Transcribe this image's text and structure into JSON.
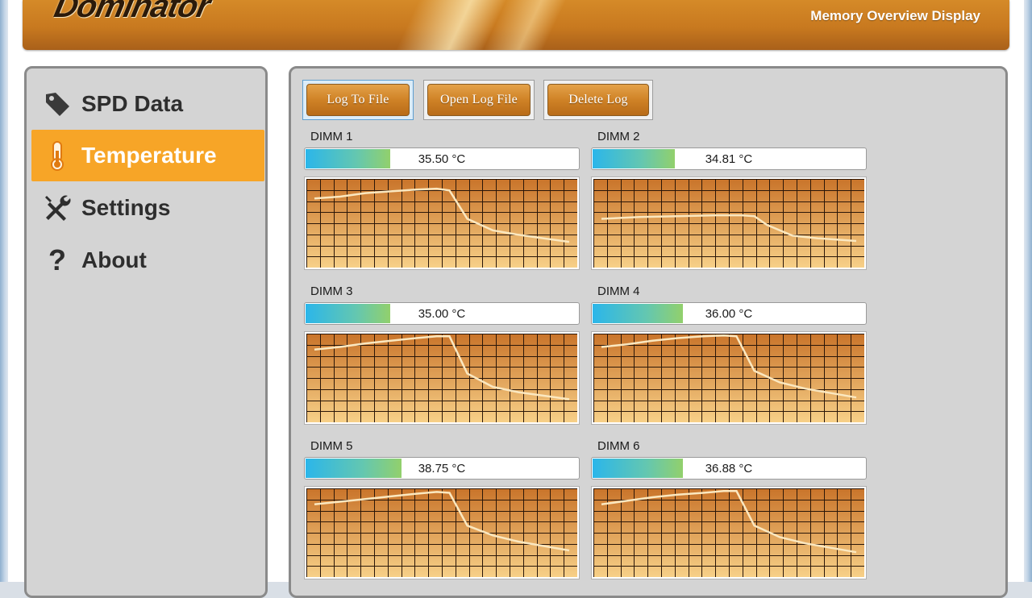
{
  "app": {
    "logo_text": "Dominator",
    "subtitle": "Memory Overview Display"
  },
  "sidebar": {
    "items": [
      {
        "label": "SPD Data",
        "icon": "tag-icon",
        "active": false
      },
      {
        "label": "Temperature",
        "icon": "thermometer-icon",
        "active": true
      },
      {
        "label": "Settings",
        "icon": "wrench-screwdriver-icon",
        "active": false
      },
      {
        "label": "About",
        "icon": "question-mark-icon",
        "active": false
      }
    ]
  },
  "toolbar": {
    "log_to_file": "Log To File",
    "open_log_file": "Open Log File",
    "delete_log": "Delete Log"
  },
  "colors": {
    "accent": "#f7a527",
    "button_orange": "#cf8226",
    "bar_start": "#2bb6ea",
    "bar_end": "#92d06c",
    "graph_top": "#c9742a",
    "graph_bottom": "#f7d088",
    "graph_line": "#fbe8c0"
  },
  "dimms": [
    {
      "label": "DIMM 1",
      "temp": "35.50 °C",
      "fill": 0.31,
      "trace": [
        [
          0,
          0.22
        ],
        [
          0.1,
          0.2
        ],
        [
          0.2,
          0.16
        ],
        [
          0.3,
          0.14
        ],
        [
          0.4,
          0.12
        ],
        [
          0.48,
          0.11
        ],
        [
          0.53,
          0.13
        ],
        [
          0.6,
          0.45
        ],
        [
          0.7,
          0.58
        ],
        [
          0.8,
          0.63
        ],
        [
          0.9,
          0.67
        ],
        [
          1,
          0.71
        ]
      ]
    },
    {
      "label": "DIMM 2",
      "temp": "34.81 °C",
      "fill": 0.3,
      "trace": [
        [
          0,
          0.45
        ],
        [
          0.15,
          0.43
        ],
        [
          0.3,
          0.42
        ],
        [
          0.45,
          0.41
        ],
        [
          0.55,
          0.41
        ],
        [
          0.6,
          0.42
        ],
        [
          0.65,
          0.52
        ],
        [
          0.75,
          0.64
        ],
        [
          0.85,
          0.67
        ],
        [
          0.95,
          0.69
        ],
        [
          1,
          0.7
        ]
      ]
    },
    {
      "label": "DIMM 3",
      "temp": "35.00 °C",
      "fill": 0.31,
      "trace": [
        [
          0,
          0.18
        ],
        [
          0.1,
          0.15
        ],
        [
          0.2,
          0.11
        ],
        [
          0.3,
          0.08
        ],
        [
          0.4,
          0.05
        ],
        [
          0.48,
          0.03
        ],
        [
          0.53,
          0.03
        ],
        [
          0.6,
          0.45
        ],
        [
          0.7,
          0.6
        ],
        [
          0.8,
          0.66
        ],
        [
          0.9,
          0.7
        ],
        [
          1,
          0.74
        ]
      ]
    },
    {
      "label": "DIMM 4",
      "temp": "36.00 °C",
      "fill": 0.33,
      "trace": [
        [
          0,
          0.15
        ],
        [
          0.1,
          0.12
        ],
        [
          0.2,
          0.08
        ],
        [
          0.3,
          0.05
        ],
        [
          0.4,
          0.03
        ],
        [
          0.48,
          0.02
        ],
        [
          0.53,
          0.03
        ],
        [
          0.6,
          0.42
        ],
        [
          0.7,
          0.55
        ],
        [
          0.8,
          0.62
        ],
        [
          0.9,
          0.67
        ],
        [
          1,
          0.72
        ]
      ]
    },
    {
      "label": "DIMM 5",
      "temp": "38.75 °C",
      "fill": 0.35,
      "trace": [
        [
          0,
          0.18
        ],
        [
          0.1,
          0.15
        ],
        [
          0.2,
          0.12
        ],
        [
          0.3,
          0.09
        ],
        [
          0.4,
          0.06
        ],
        [
          0.48,
          0.04
        ],
        [
          0.53,
          0.05
        ],
        [
          0.6,
          0.42
        ],
        [
          0.7,
          0.53
        ],
        [
          0.8,
          0.6
        ],
        [
          0.9,
          0.65
        ],
        [
          1,
          0.7
        ]
      ]
    },
    {
      "label": "DIMM 6",
      "temp": "36.88 °C",
      "fill": 0.33,
      "trace": [
        [
          0,
          0.18
        ],
        [
          0.1,
          0.14
        ],
        [
          0.2,
          0.1
        ],
        [
          0.3,
          0.07
        ],
        [
          0.4,
          0.05
        ],
        [
          0.48,
          0.03
        ],
        [
          0.53,
          0.03
        ],
        [
          0.6,
          0.42
        ],
        [
          0.7,
          0.55
        ],
        [
          0.8,
          0.62
        ],
        [
          0.9,
          0.67
        ],
        [
          1,
          0.72
        ]
      ]
    }
  ]
}
